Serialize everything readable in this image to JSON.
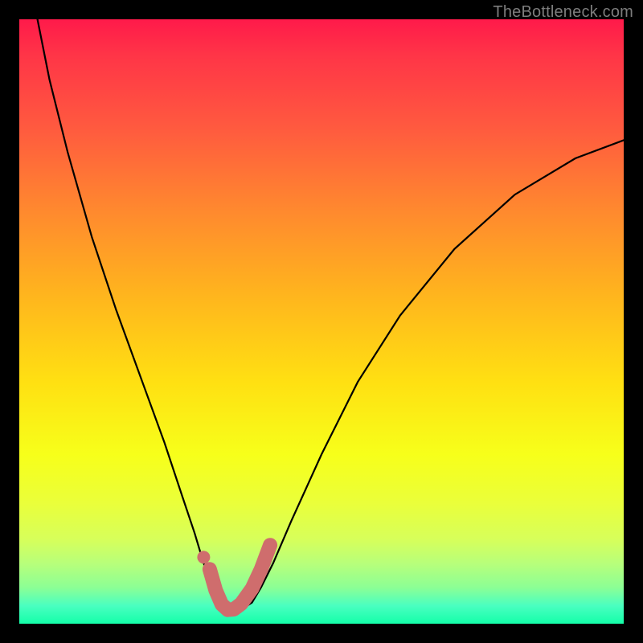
{
  "watermark": "TheBottleneck.com",
  "colors": {
    "background_outer": "#000000",
    "gradient_top": "#ff1a4a",
    "gradient_bottom": "#14ffa9",
    "curve": "#000000",
    "marker": "#cf6d6d",
    "watermark_text": "#7d7d7d"
  },
  "chart_data": {
    "type": "line",
    "title": "",
    "xlabel": "",
    "ylabel": "",
    "xlim": [
      0,
      100
    ],
    "ylim": [
      0,
      100
    ],
    "grid": false,
    "legend": false,
    "note": "Axes are unlabeled in the source image; values are normalized 0–100 estimates read from pixel positions. y is plotted with 100 at the top and 0 at the bottom.",
    "series": [
      {
        "name": "curve",
        "x": [
          3,
          5,
          8,
          12,
          16,
          20,
          24,
          27,
          29,
          30.5,
          32,
          33.2,
          34,
          35,
          36.5,
          38.5,
          40,
          42,
          45,
          50,
          56,
          63,
          72,
          82,
          92,
          100
        ],
        "y": [
          100,
          90,
          78,
          64,
          52,
          41,
          30,
          21,
          15,
          10,
          6,
          3.5,
          2.2,
          2,
          2.2,
          3.5,
          6,
          10,
          17,
          28,
          40,
          51,
          62,
          71,
          77,
          80
        ]
      }
    ],
    "highlight": {
      "name": "bottleneck-marker",
      "description": "Salmon U-shaped marker at curve minimum plus a separate dot just above-left",
      "dot": {
        "x": 30.5,
        "y": 11
      },
      "path_x": [
        31.5,
        32.5,
        33.5,
        34.5,
        35.5,
        36.7,
        38.5,
        40,
        41.5
      ],
      "path_y": [
        9,
        5.5,
        3.2,
        2.3,
        2.4,
        3.3,
        5.8,
        9,
        13
      ]
    }
  }
}
